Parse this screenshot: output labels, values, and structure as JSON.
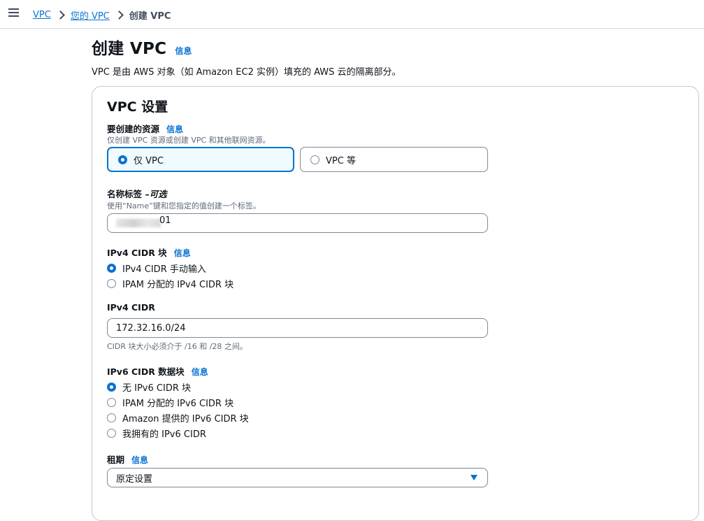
{
  "breadcrumb": {
    "items": [
      "VPC",
      "您的 VPC"
    ],
    "current": "创建 VPC"
  },
  "page": {
    "title": "创建 VPC",
    "info": "信息",
    "description": "VPC 是由 AWS 对象（如 Amazon EC2 实例）填充的 AWS 云的隔离部分。"
  },
  "vpc_settings": {
    "title": "VPC 设置",
    "resources": {
      "label": "要创建的资源",
      "info": "信息",
      "description": "仅创建 VPC 资源或创建 VPC 和其他联网资源。",
      "options": [
        "仅 VPC",
        "VPC 等"
      ],
      "selected_index": 0
    },
    "name_tag": {
      "label": "名称标签 – ",
      "optional": "可选",
      "description": "使用“Name”键和您指定的值创建一个标签。",
      "value_visible_suffix": "01"
    },
    "ipv4_block": {
      "label": "IPv4 CIDR 块",
      "info": "信息",
      "options": [
        "IPv4 CIDR 手动输入",
        "IPAM 分配的 IPv4 CIDR 块"
      ],
      "selected_index": 0
    },
    "ipv4_cidr": {
      "label": "IPv4 CIDR",
      "value": "172.32.16.0/24",
      "hint": "CIDR 块大小必须介于 /16 和 /28 之间。"
    },
    "ipv6_block": {
      "label": "IPv6 CIDR 数据块",
      "info": "信息",
      "options": [
        "无 IPv6 CIDR 块",
        "IPAM 分配的 IPv6 CIDR 块",
        "Amazon 提供的 IPv6 CIDR 块",
        "我拥有的 IPv6 CIDR"
      ],
      "selected_index": 0
    },
    "tenancy": {
      "label": "租期",
      "info": "信息",
      "value": "原定设置"
    }
  },
  "colors": {
    "accent": "#0972d3",
    "border": "#7d8998",
    "selected_bg": "#f0fbff"
  }
}
